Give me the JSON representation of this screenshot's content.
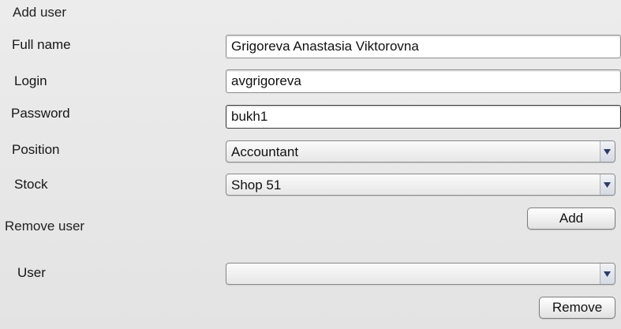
{
  "add_user": {
    "title": "Add user",
    "full_name": {
      "label": "Full name",
      "value": "Grigoreva Anastasia Viktorovna"
    },
    "login": {
      "label": "Login",
      "value": "avgrigoreva"
    },
    "password": {
      "label": "Password",
      "value": "bukh1"
    },
    "position": {
      "label": "Position",
      "value": "Accountant"
    },
    "stock": {
      "label": "Stock",
      "value": "Shop 51"
    },
    "add_button": "Add"
  },
  "remove_user": {
    "title": "Remove user",
    "user": {
      "label": "User",
      "value": ""
    },
    "remove_button": "Remove"
  },
  "icons": {
    "dropdown": "chevron-down-icon"
  }
}
